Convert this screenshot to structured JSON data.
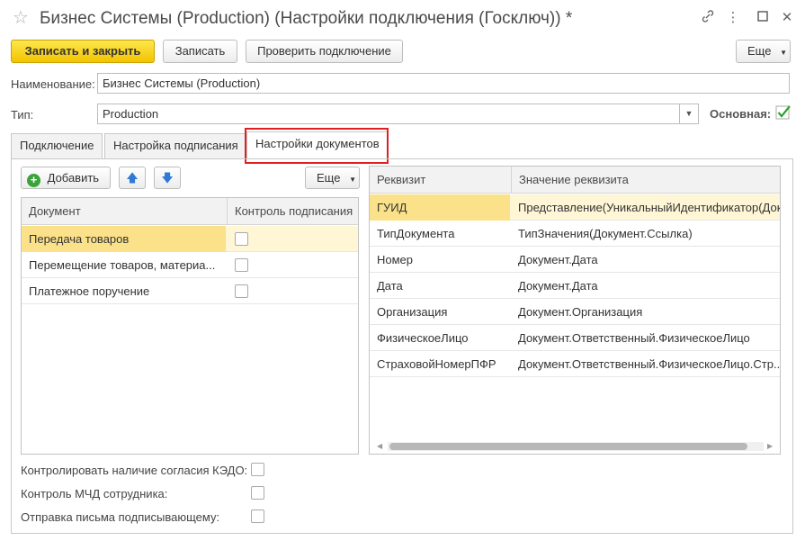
{
  "window": {
    "title": "Бизнес Системы (Production) (Настройки подключения (Госключ)) *",
    "star_icon": "star-icon",
    "more_icon": "link-icon"
  },
  "toolbar": {
    "save_close_label": "Записать и закрыть",
    "save_label": "Записать",
    "check_connection_label": "Проверить подключение",
    "more_label": "Еще"
  },
  "form": {
    "name_label": "Наименование:",
    "name_value": "Бизнес Системы (Production)",
    "type_label": "Тип:",
    "type_value": "Production",
    "main_label": "Основная:",
    "main_checked": true
  },
  "tabs": [
    {
      "label": "Подключение"
    },
    {
      "label": "Настройка подписания"
    },
    {
      "label": "Настройки документов"
    }
  ],
  "docs_toolbar": {
    "add_label": "Добавить",
    "more_label": "Еще"
  },
  "documents": {
    "columns": [
      "Документ",
      "Контроль подписания"
    ],
    "rows": [
      {
        "name": "Передача товаров",
        "checked": false
      },
      {
        "name": "Перемещение товаров, материа...",
        "checked": false
      },
      {
        "name": "Платежное поручение",
        "checked": false
      }
    ]
  },
  "requisites": {
    "columns": [
      "Реквизит",
      "Значение реквизита"
    ],
    "rows": [
      {
        "name": "ГУИД",
        "value": "Представление(УникальныйИдентификатор(Док..."
      },
      {
        "name": "ТипДокумента",
        "value": "ТипЗначения(Документ.Ссылка)"
      },
      {
        "name": "Номер",
        "value": "Документ.Дата"
      },
      {
        "name": "Дата",
        "value": "Документ.Дата"
      },
      {
        "name": "Организация",
        "value": "Документ.Организация"
      },
      {
        "name": "ФизическоеЛицо",
        "value": "Документ.Ответственный.ФизическоеЛицо"
      },
      {
        "name": "СтраховойНомерПФР",
        "value": "Документ.Ответственный.ФизическоеЛицо.Стр..."
      }
    ]
  },
  "options": [
    {
      "label": "Контролировать наличие согласия КЭДО:",
      "checked": false
    },
    {
      "label": "Контроль МЧД сотрудника:",
      "checked": false
    },
    {
      "label": "Отправка письма подписывающему:",
      "checked": false
    }
  ],
  "colors": {
    "accent": "#f3c400",
    "selected_row": "#fbe18a",
    "highlight": "#e02020",
    "check": "#2aa42a"
  }
}
